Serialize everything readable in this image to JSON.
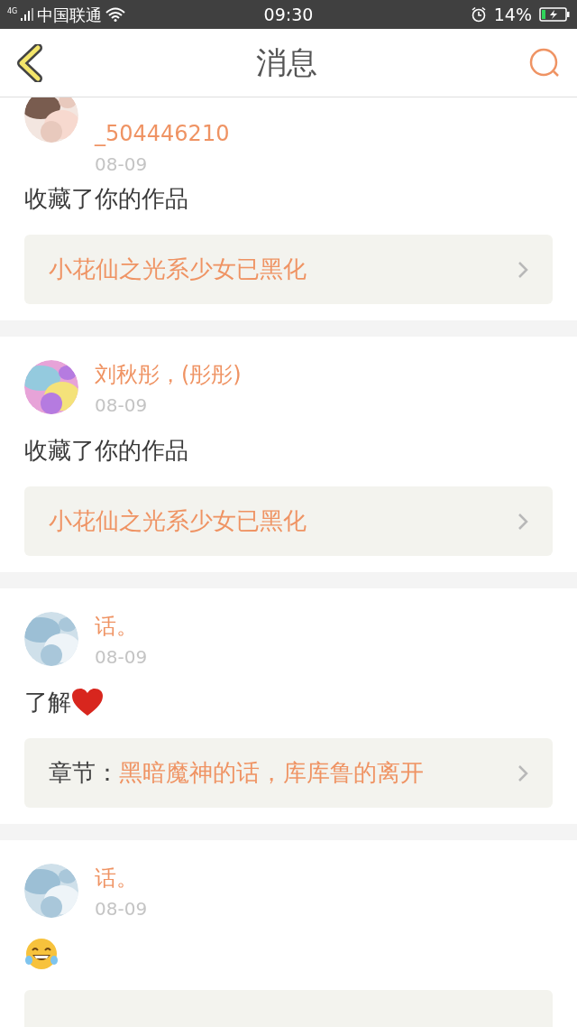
{
  "status_bar": {
    "network": "4G",
    "carrier": "中国联通",
    "time": "09:30",
    "battery": "14%"
  },
  "header": {
    "title": "消息"
  },
  "messages": [
    {
      "name": "_504446210",
      "date": "08-09",
      "body": "收藏了你的作品",
      "link_title": "小花仙之光系少女已黑化"
    },
    {
      "name": "刘秋彤，(彤彤)",
      "date": "08-09",
      "body": "收藏了你的作品",
      "link_title": "小花仙之光系少女已黑化"
    },
    {
      "kind": "heart",
      "name": "话。",
      "date": "08-09",
      "body": "了解",
      "link_label": "章节：",
      "link_title": "黑暗魔神的话，库库鲁的离开"
    },
    {
      "kind": "laugh",
      "name": "话。",
      "date": "08-09"
    }
  ]
}
